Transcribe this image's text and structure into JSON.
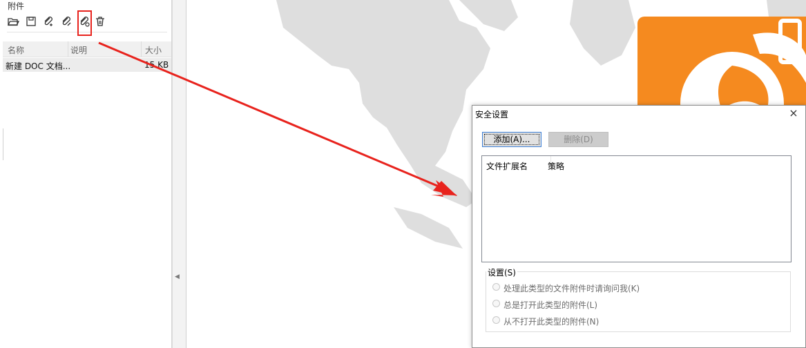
{
  "left_panel": {
    "title": "附件",
    "toolbar_icons": [
      "open-folder-icon",
      "save-icon",
      "add-attachment-icon",
      "edit-attachment-icon",
      "attachment-settings-icon",
      "delete-icon"
    ],
    "columns": {
      "name": "名称",
      "description": "说明",
      "size": "大小"
    },
    "rows": [
      {
        "name": "新建 DOC 文档...",
        "description": "",
        "size": "15 KB"
      }
    ]
  },
  "dialog": {
    "title": "安全设置",
    "close": "×",
    "add_button": "添加(A)...",
    "delete_button": "删除(D)",
    "list_columns": {
      "extension": "文件扩展名",
      "policy": "策略"
    },
    "settings_group": "设置(S)",
    "options": [
      "处理此类型的文件附件时请询问我(K)",
      "总是打开此类型的附件(L)",
      "从不打开此类型的附件(N)"
    ]
  },
  "colors": {
    "annotation_red": "#e8231d",
    "brand_orange": "#f58a1f",
    "map_gray": "#dedede"
  }
}
